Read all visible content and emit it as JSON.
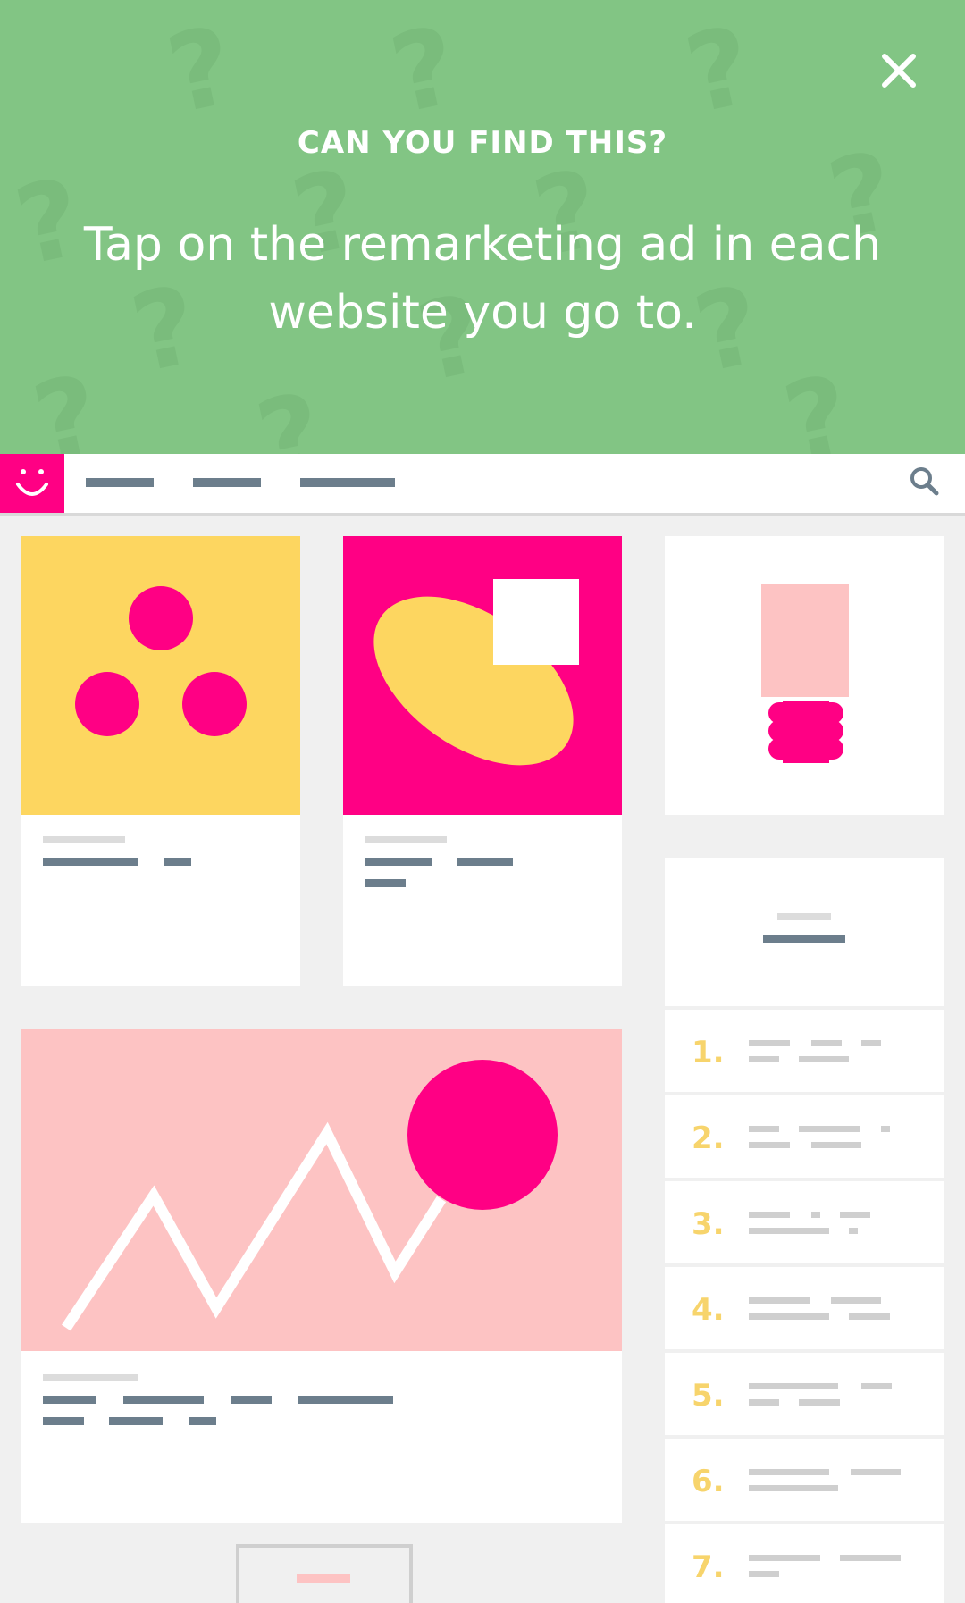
{
  "header": {
    "title": "CAN YOU FIND THIS?",
    "subtitle": "Tap on the remarketing ad in each website you go to.",
    "close_icon": "close-icon",
    "background_color": "#82c584"
  },
  "mock_site": {
    "logo_icon": "smiley-icon",
    "search_icon": "search-icon",
    "accent_pink": "#ff0084",
    "accent_yellow": "#fdd660",
    "light_pink": "#fdc3c3",
    "list_numbers": [
      "1.",
      "2.",
      "3.",
      "4.",
      "5.",
      "6.",
      "7."
    ]
  }
}
